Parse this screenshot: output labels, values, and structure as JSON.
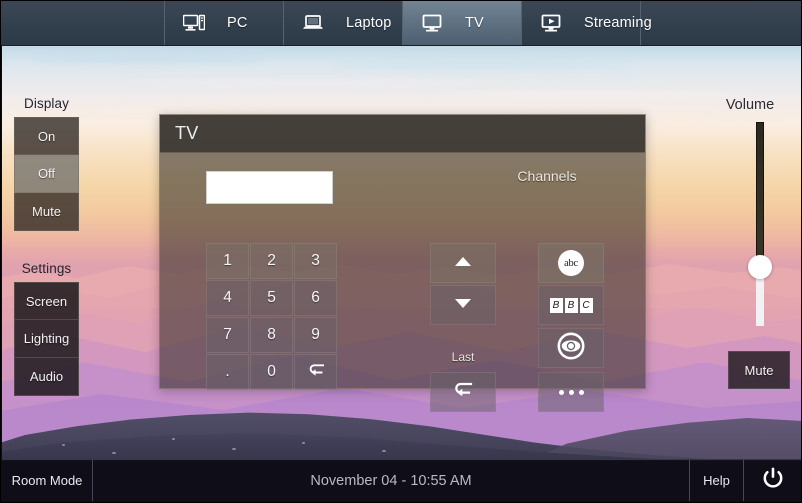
{
  "topbar": {
    "tabs": [
      {
        "id": "pc",
        "label": "PC",
        "icon": "desktop-tower-icon",
        "active": false
      },
      {
        "id": "laptop",
        "label": "Laptop",
        "icon": "laptop-icon",
        "active": false
      },
      {
        "id": "tv",
        "label": "TV",
        "icon": "monitor-icon",
        "active": true
      },
      {
        "id": "streaming",
        "label": "Streaming",
        "icon": "media-play-icon",
        "active": false
      }
    ]
  },
  "sidebar": {
    "display": {
      "heading": "Display",
      "buttons": [
        {
          "label": "On",
          "state": "normal"
        },
        {
          "label": "Off",
          "state": "highlight"
        },
        {
          "label": "Mute",
          "state": "normal"
        }
      ]
    },
    "settings": {
      "heading": "Settings",
      "buttons": [
        {
          "label": "Screen",
          "state": "dark"
        },
        {
          "label": "Lighting",
          "state": "dark"
        },
        {
          "label": "Audio",
          "state": "dark"
        }
      ]
    }
  },
  "panel": {
    "title": "TV",
    "entry_value": "",
    "keypad": [
      "1",
      "2",
      "3",
      "4",
      "5",
      "6",
      "7",
      "8",
      "9",
      ".",
      "0",
      "↵"
    ],
    "channels_label": "Channels",
    "channel_up_icon": "triangle-up-icon",
    "channel_down_icon": "triangle-down-icon",
    "last_label": "Last",
    "last_icon": "return-arrow-icon",
    "presets": [
      {
        "id": "abc",
        "text": "abc",
        "icon": "abc-logo-icon"
      },
      {
        "id": "bbc",
        "letters": [
          "B",
          "B",
          "C"
        ],
        "icon": "bbc-logo-icon"
      },
      {
        "id": "cbs",
        "text": "",
        "icon": "cbs-eye-logo-icon"
      },
      {
        "id": "more",
        "text": "",
        "icon": "ellipsis-icon"
      }
    ]
  },
  "volume": {
    "label": "Volume",
    "level_percent": 29,
    "mute_label": "Mute"
  },
  "bottombar": {
    "room_mode": "Room Mode",
    "clock": "November 04 - 10:55 AM",
    "help": "Help",
    "power_icon": "power-icon"
  },
  "colors": {
    "topbar_bg": "#33414f",
    "tab_active": "#b7cfdf",
    "panel_bg": "#342e28",
    "bottombar_bg": "#100e18",
    "accent_white": "#ffffff"
  }
}
